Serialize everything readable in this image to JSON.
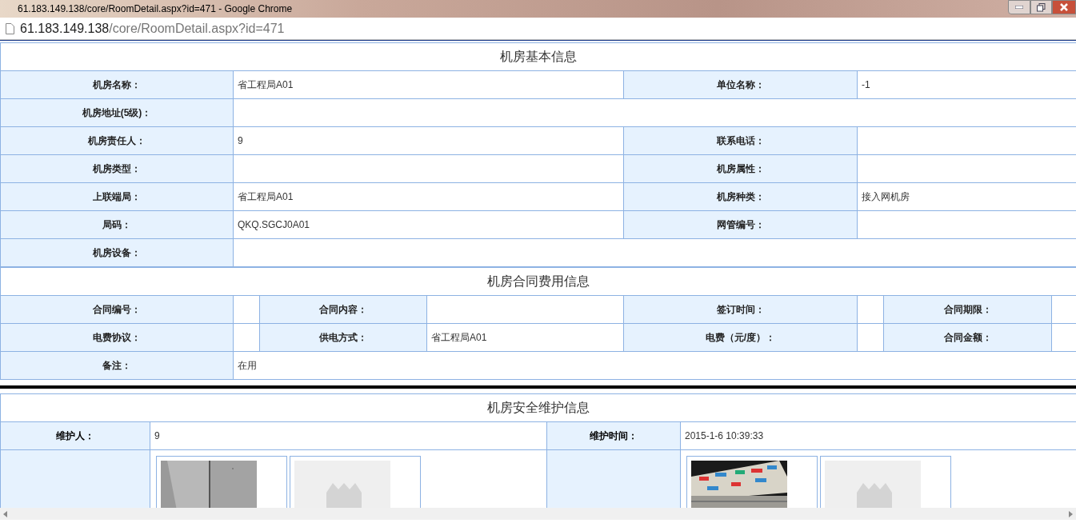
{
  "window": {
    "title": "61.183.149.138/core/RoomDetail.aspx?id=471 - Google Chrome"
  },
  "address_bar": {
    "host": "61.183.149.138",
    "path": "/core/RoomDetail.aspx?id=471"
  },
  "sections": [
    {
      "title": "机房基本信息",
      "rows": [
        {
          "fields": [
            {
              "label": "机房名称：",
              "value": "省工程局A01"
            },
            {
              "label": "单位名称：",
              "value": "-1"
            }
          ]
        },
        {
          "fields": [
            {
              "label": "机房地址(5级)："
            }
          ]
        },
        {
          "fields": [
            {
              "label": "机房责任人：",
              "value": "9"
            },
            {
              "label": "联系电话："
            }
          ]
        },
        {
          "fields": [
            {
              "label": "机房类型："
            },
            {
              "label": "机房属性："
            }
          ]
        },
        {
          "fields": [
            {
              "label": "上联端局：",
              "value": "省工程局A01"
            },
            {
              "label": "机房种类：",
              "value": "接入网机房"
            }
          ]
        },
        {
          "fields": [
            {
              "label": "局码：",
              "value": "QKQ.SGCJ0A01"
            },
            {
              "label": "网管编号："
            }
          ]
        },
        {
          "fields": [
            {
              "label": "机房设备："
            }
          ]
        }
      ]
    },
    {
      "title": "机房合同费用信息",
      "rows": [
        {
          "fields": [
            {
              "label": "合同编号："
            },
            {
              "label": "合同内容："
            },
            {
              "label": "签订时间："
            },
            {
              "label": "合同期限："
            }
          ]
        },
        {
          "fields": [
            {
              "label": "电费协议："
            },
            {
              "label": "供电方式：",
              "value": "省工程局A01"
            },
            {
              "label": "电费（元/度）："
            },
            {
              "label": "合同金额："
            }
          ]
        },
        {
          "fields": [
            {
              "label": "备注：",
              "value": "在用"
            }
          ]
        }
      ]
    }
  ],
  "maintenance": {
    "title": "机房安全维护信息",
    "fields": [
      {
        "label": "维护人：",
        "value": "9"
      },
      {
        "label": "维护时间：",
        "value": "2015-1-6 10:39:33"
      }
    ],
    "photo_groups": [
      {
        "photos": [
          {
            "kind": "wall"
          },
          {
            "kind": "placeholder"
          }
        ]
      },
      {
        "photos": [
          {
            "kind": "battery"
          },
          {
            "kind": "placeholder"
          }
        ]
      }
    ]
  }
}
